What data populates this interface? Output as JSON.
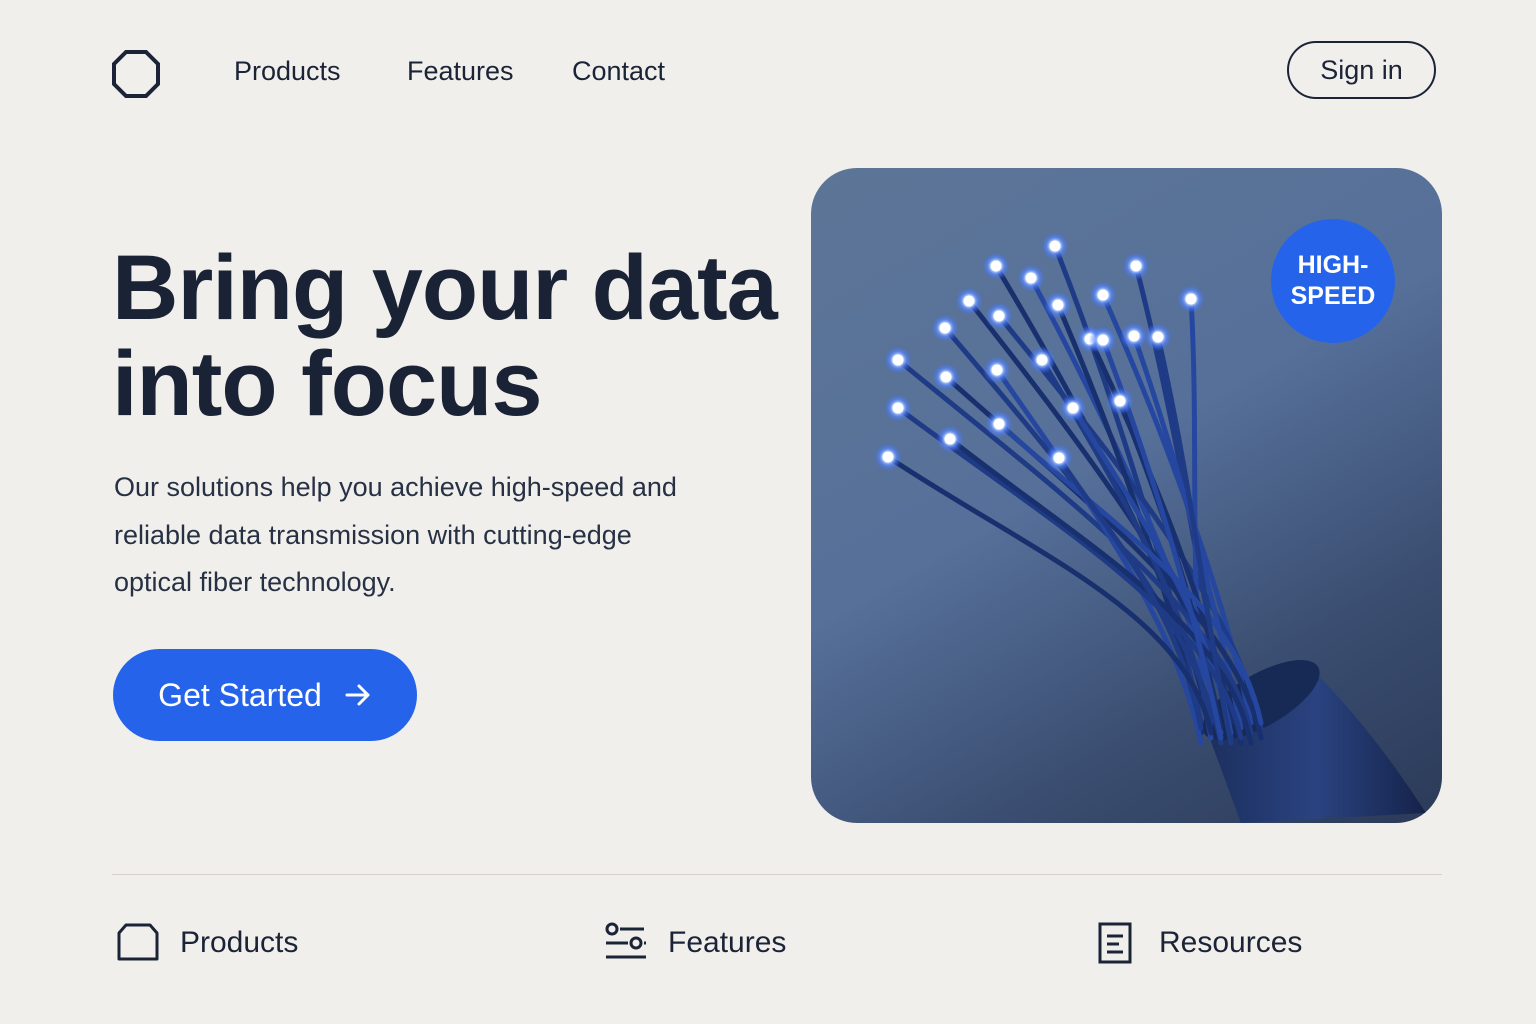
{
  "nav": {
    "logo_icon": "octagon-logo-icon",
    "links": [
      "Products",
      "Features",
      "Contact"
    ],
    "sign_in": "Sign in"
  },
  "hero": {
    "headline_line1": "Bring your data",
    "headline_line2": "into focus",
    "subtext": "Our solutions help you achieve high-speed and reliable data transmission with cutting-edge optical fiber technology.",
    "cta_label": "Get Started",
    "cta_icon": "arrow-right-icon",
    "badge_line1": "HIGH-",
    "badge_line2": "SPEED",
    "image_subject": "optical-fiber-cable-illustration"
  },
  "features_bar": [
    {
      "label": "Products",
      "icon": "box-icon"
    },
    {
      "label": "Features",
      "icon": "sliders-icon"
    },
    {
      "label": "Resources",
      "icon": "document-icon"
    }
  ],
  "colors": {
    "background": "#f1efec",
    "text": "#1b2436",
    "accent": "#2563eb"
  }
}
